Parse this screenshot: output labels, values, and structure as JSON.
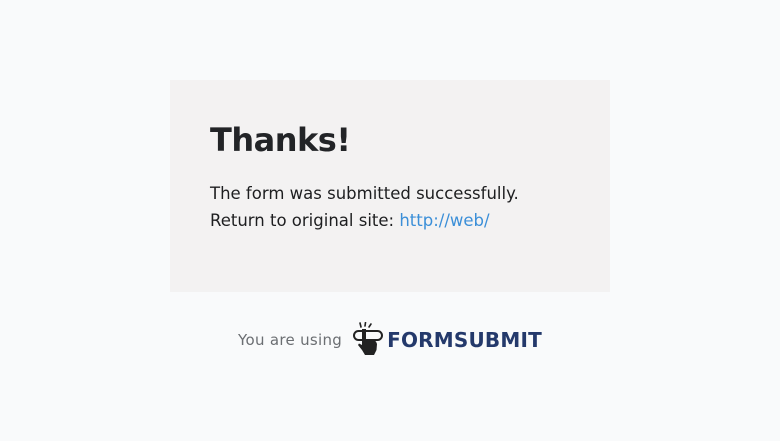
{
  "card": {
    "title": "Thanks!",
    "message": "The form was submitted successfully.",
    "return_label": "Return to original site: ",
    "return_link": "http://web/"
  },
  "footer": {
    "label": "You are using",
    "brand": "FORMSUBMIT",
    "brand_icon": "pointing-hand-icon"
  },
  "colors": {
    "background": "#f9fafb",
    "card_background": "#f3f2f2",
    "link": "#3b8fd8",
    "brand": "#24396b"
  }
}
